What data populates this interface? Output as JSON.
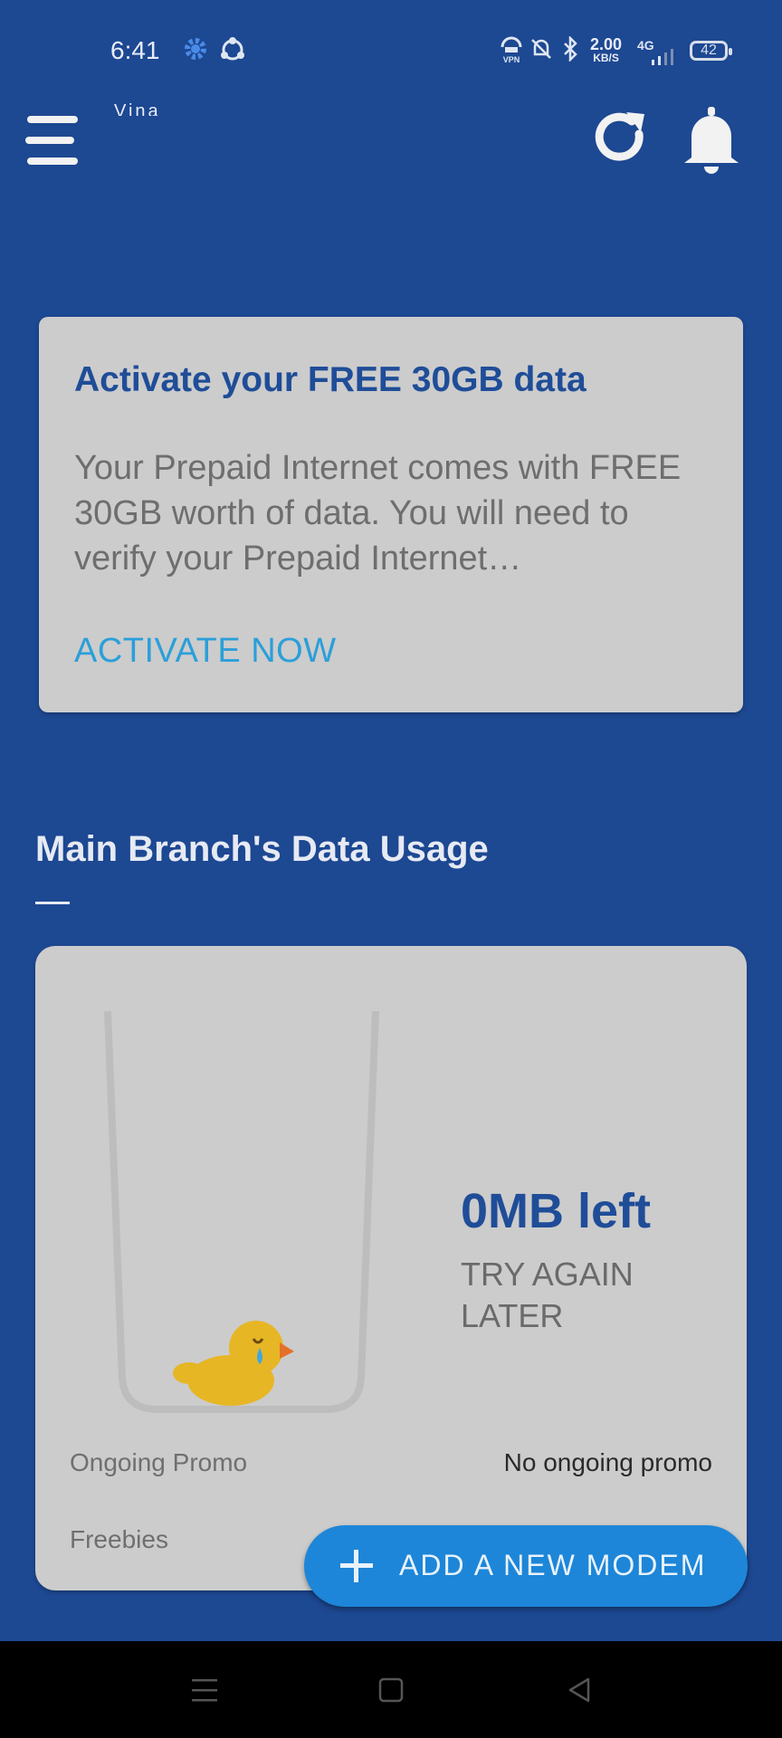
{
  "status_bar": {
    "time": "6:41",
    "net_speed_value": "2.00",
    "net_speed_unit": "KB/S",
    "network_type": "4G",
    "battery": "42"
  },
  "app_bar": {
    "title": "Vina",
    "icons": [
      "menu-icon",
      "refresh-icon",
      "bell-icon"
    ]
  },
  "activate_card": {
    "title": "Activate your FREE 30GB data",
    "body": "Your Prepaid Internet comes with FREE 30GB worth of data. You will need to verify your Prepaid Internet…",
    "action_label": "ACTIVATE NOW"
  },
  "usage_section": {
    "title": "Main Branch's Data Usage"
  },
  "usage_card": {
    "amount_left": "0MB left",
    "status": "TRY AGAIN LATER",
    "fill_fraction": 0,
    "rows": [
      {
        "label": "Ongoing Promo",
        "value": "No ongoing promo"
      },
      {
        "label": "Freebies",
        "value": ""
      }
    ]
  },
  "fab": {
    "label": "ADD A NEW MODEM",
    "icon": "plus-icon"
  },
  "nav_bar": {
    "icons": [
      "recents-icon",
      "home-icon",
      "back-icon"
    ]
  },
  "colors": {
    "background": "#1d4892",
    "card": "#cccccc",
    "title_blue": "#1f4d98",
    "link_blue": "#2b9fd9",
    "fab": "#1d86d8"
  }
}
